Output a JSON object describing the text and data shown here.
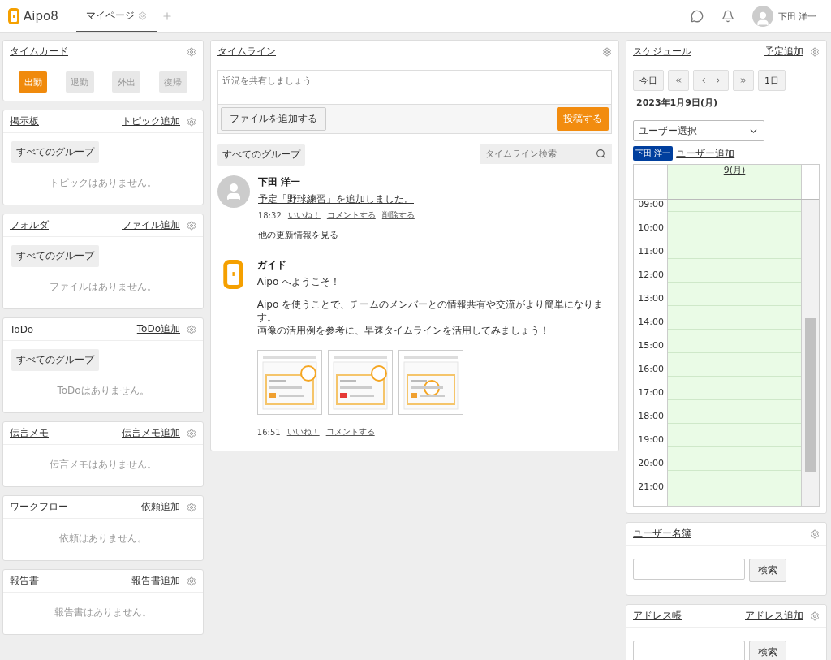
{
  "header": {
    "logo": "Aipo8",
    "tabs": [
      {
        "label": "マイページ",
        "selected": true
      }
    ],
    "user_name": "下田 洋一"
  },
  "left_panels": [
    {
      "kind": "timecard",
      "title": "タイムカード",
      "buttons": [
        {
          "label": "出勤",
          "enabled": true
        },
        {
          "label": "退勤",
          "enabled": false
        },
        {
          "label": "外出",
          "enabled": false
        },
        {
          "label": "復帰",
          "enabled": false
        }
      ]
    },
    {
      "kind": "list",
      "title": "掲示板",
      "action": "トピック追加",
      "group": "すべてのグループ",
      "empty": "トピックはありません。"
    },
    {
      "kind": "list",
      "title": "フォルダ",
      "action": "ファイル追加",
      "group": "すべてのグループ",
      "empty": "ファイルはありません。"
    },
    {
      "kind": "list",
      "title": "ToDo",
      "action": "ToDo追加",
      "group": "すべてのグループ",
      "empty": "ToDoはありません。"
    },
    {
      "kind": "simple",
      "title": "伝言メモ",
      "action": "伝言メモ追加",
      "empty": "伝言メモはありません。"
    },
    {
      "kind": "simple",
      "title": "ワークフロー",
      "action": "依頼追加",
      "empty": "依頼はありません。"
    },
    {
      "kind": "simple",
      "title": "報告書",
      "action": "報告書追加",
      "empty": "報告書はありません。"
    }
  ],
  "timeline": {
    "title": "タイムライン",
    "placeholder": "近況を共有しましょう",
    "add_file": "ファイルを追加する",
    "post": "投稿する",
    "group": "すべてのグループ",
    "search_placeholder": "タイムライン検索",
    "posts": [
      {
        "kind": "user",
        "author": "下田 洋一",
        "paragraphs": [
          [
            "予定「野球練習」を追加しました。"
          ]
        ],
        "time": "18:32",
        "actions": [
          "いいね！",
          "コメントする",
          "削除する"
        ],
        "more": "他の更新情報を見る"
      },
      {
        "kind": "guide",
        "author": "ガイド",
        "paragraphs": [
          [
            "Aipo へようこそ！"
          ],
          [
            "Aipo を使うことで、チームのメンバーとの情報共有や交流がより簡単になります。",
            "画像の活用例を参考に、早速タイムラインを活用してみましょう！"
          ]
        ],
        "images": [
          {
            "kind": "picture"
          },
          {
            "kind": "picture"
          },
          {
            "kind": "picture"
          }
        ],
        "time": "16:51",
        "actions": [
          "いいね！",
          "コメントする"
        ]
      }
    ]
  },
  "schedule": {
    "title": "スケジュール",
    "action": "予定追加",
    "today": "今日",
    "range": "1日",
    "date": "2023年1月9日(月)",
    "user_select": "ユーザー選択",
    "user_tag": "下田 洋一",
    "add_user": "ユーザー追加",
    "day": "9(月)",
    "hours": [
      "09:00",
      "10:00",
      "11:00",
      "12:00",
      "13:00",
      "14:00",
      "15:00",
      "16:00",
      "17:00",
      "18:00",
      "19:00",
      "20:00",
      "21:00"
    ]
  },
  "directories": [
    {
      "title": "ユーザー名簿",
      "search": "検索"
    },
    {
      "title": "アドレス帳",
      "action": "アドレス追加",
      "search": "検索"
    }
  ]
}
